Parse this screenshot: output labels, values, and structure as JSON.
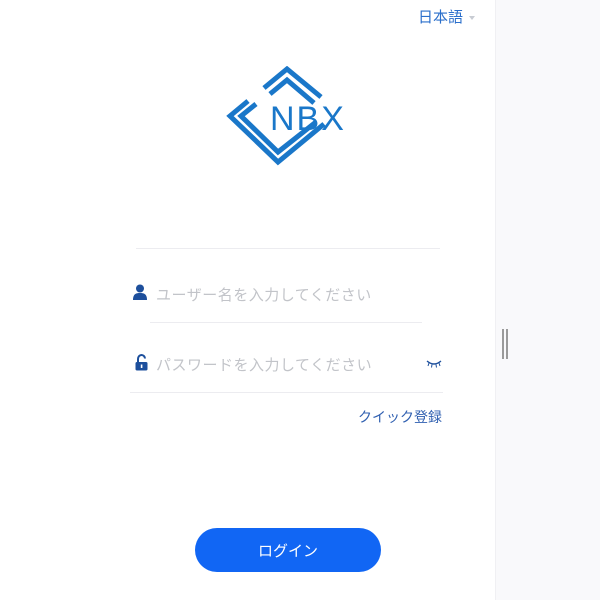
{
  "header": {
    "language_label": "日本語"
  },
  "logo": {
    "text": "NBX",
    "color": "#1a77c9"
  },
  "form": {
    "username_placeholder": "ユーザー名を入力してください",
    "password_placeholder": "パスワードを入力してください",
    "quick_register_label": "クイック登録",
    "login_label": "ログイン"
  },
  "icons": {
    "language_chevron": "chevron-down-icon",
    "username": "user-icon",
    "password": "unlock-icon",
    "visibility": "eye-closed-icon"
  },
  "colors": {
    "accent": "#1166f4",
    "link": "#2f5fb0",
    "placeholder": "#c2c4c9"
  }
}
